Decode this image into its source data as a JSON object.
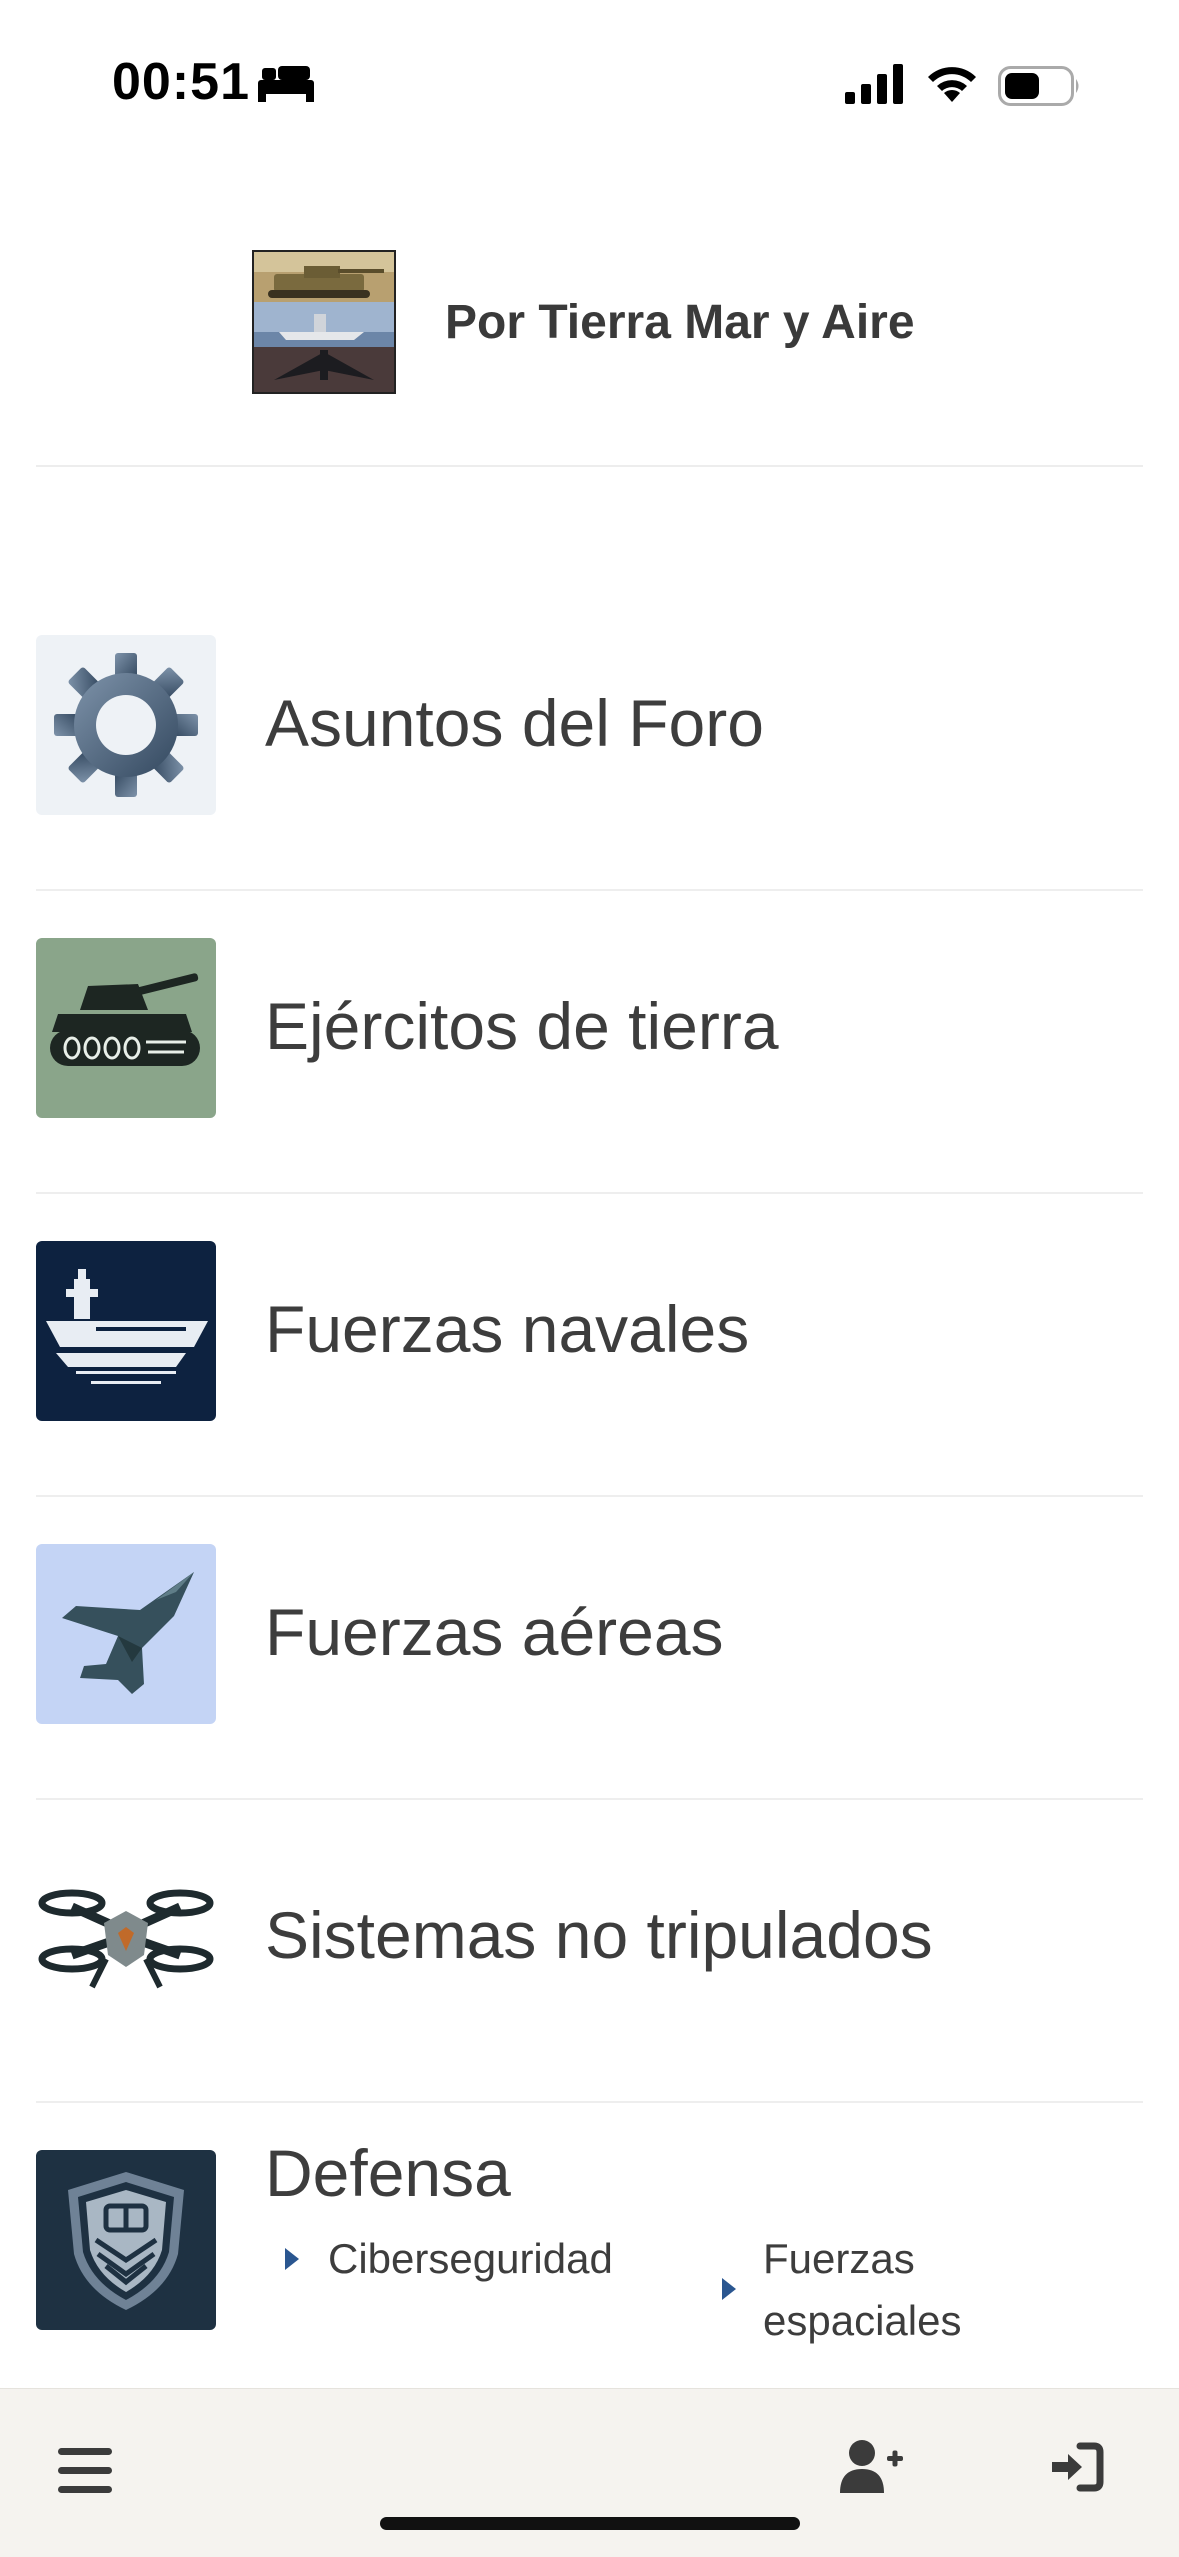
{
  "status_bar": {
    "time": "00:51"
  },
  "header": {
    "site_title": "Por Tierra Mar y Aire"
  },
  "forums": [
    {
      "title": "Asuntos del Foro",
      "icon": "gear-icon"
    },
    {
      "title": "Ejércitos de tierra",
      "icon": "tank-icon"
    },
    {
      "title": "Fuerzas navales",
      "icon": "aircraft-carrier-icon"
    },
    {
      "title": "Fuerzas aéreas",
      "icon": "jet-fighter-icon"
    },
    {
      "title": "Sistemas no tripulados",
      "icon": "drone-icon"
    },
    {
      "title": "Defensa",
      "icon": "shield-icon",
      "subforums": [
        "Ciberseguridad",
        "Fuerzas espaciales"
      ]
    }
  ],
  "bottom_nav": {
    "menu": "menu-icon",
    "register": "add-user-icon",
    "login": "login-icon"
  },
  "colors": {
    "background": "#ffffff",
    "bottom_bar": "#f5f3ef",
    "subforum_caret": "#2a5690",
    "tank_bg": "#8aa58a",
    "navy_bg": "#0d2240",
    "air_bg": "#c4d4f5",
    "defense_bg": "#1e3142"
  }
}
